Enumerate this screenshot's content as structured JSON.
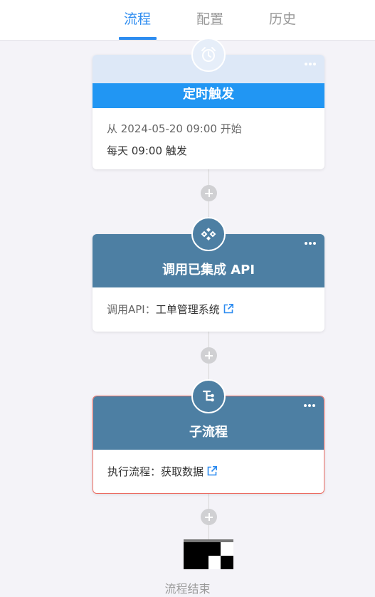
{
  "tabs": [
    {
      "label": "流程",
      "active": true
    },
    {
      "label": "配置",
      "active": false
    },
    {
      "label": "历史",
      "active": false
    }
  ],
  "colors": {
    "accent": "#2d8cf0",
    "node_header": "#4d7fa3",
    "trigger_header": "#2196f3",
    "trigger_header_top": "#dde8f7",
    "selected_border": "#ec6b62"
  },
  "nodes": {
    "trigger": {
      "icon": "alarm-clock-icon",
      "title": "定时触发",
      "line1": "从 2024-05-20 09:00 开始",
      "line2": "每天 09:00 触发"
    },
    "api": {
      "icon": "api-integration-icon",
      "title": "调用已集成 API",
      "label": "调用API：",
      "value": "工单管理系统",
      "link_icon": "external-link-icon"
    },
    "subflow": {
      "icon": "subflow-icon",
      "title": "子流程",
      "label": "执行流程：",
      "value": "获取数据",
      "link_icon": "external-link-icon"
    }
  },
  "end": {
    "icon": "checkered-flag-icon",
    "label": "流程结束"
  }
}
